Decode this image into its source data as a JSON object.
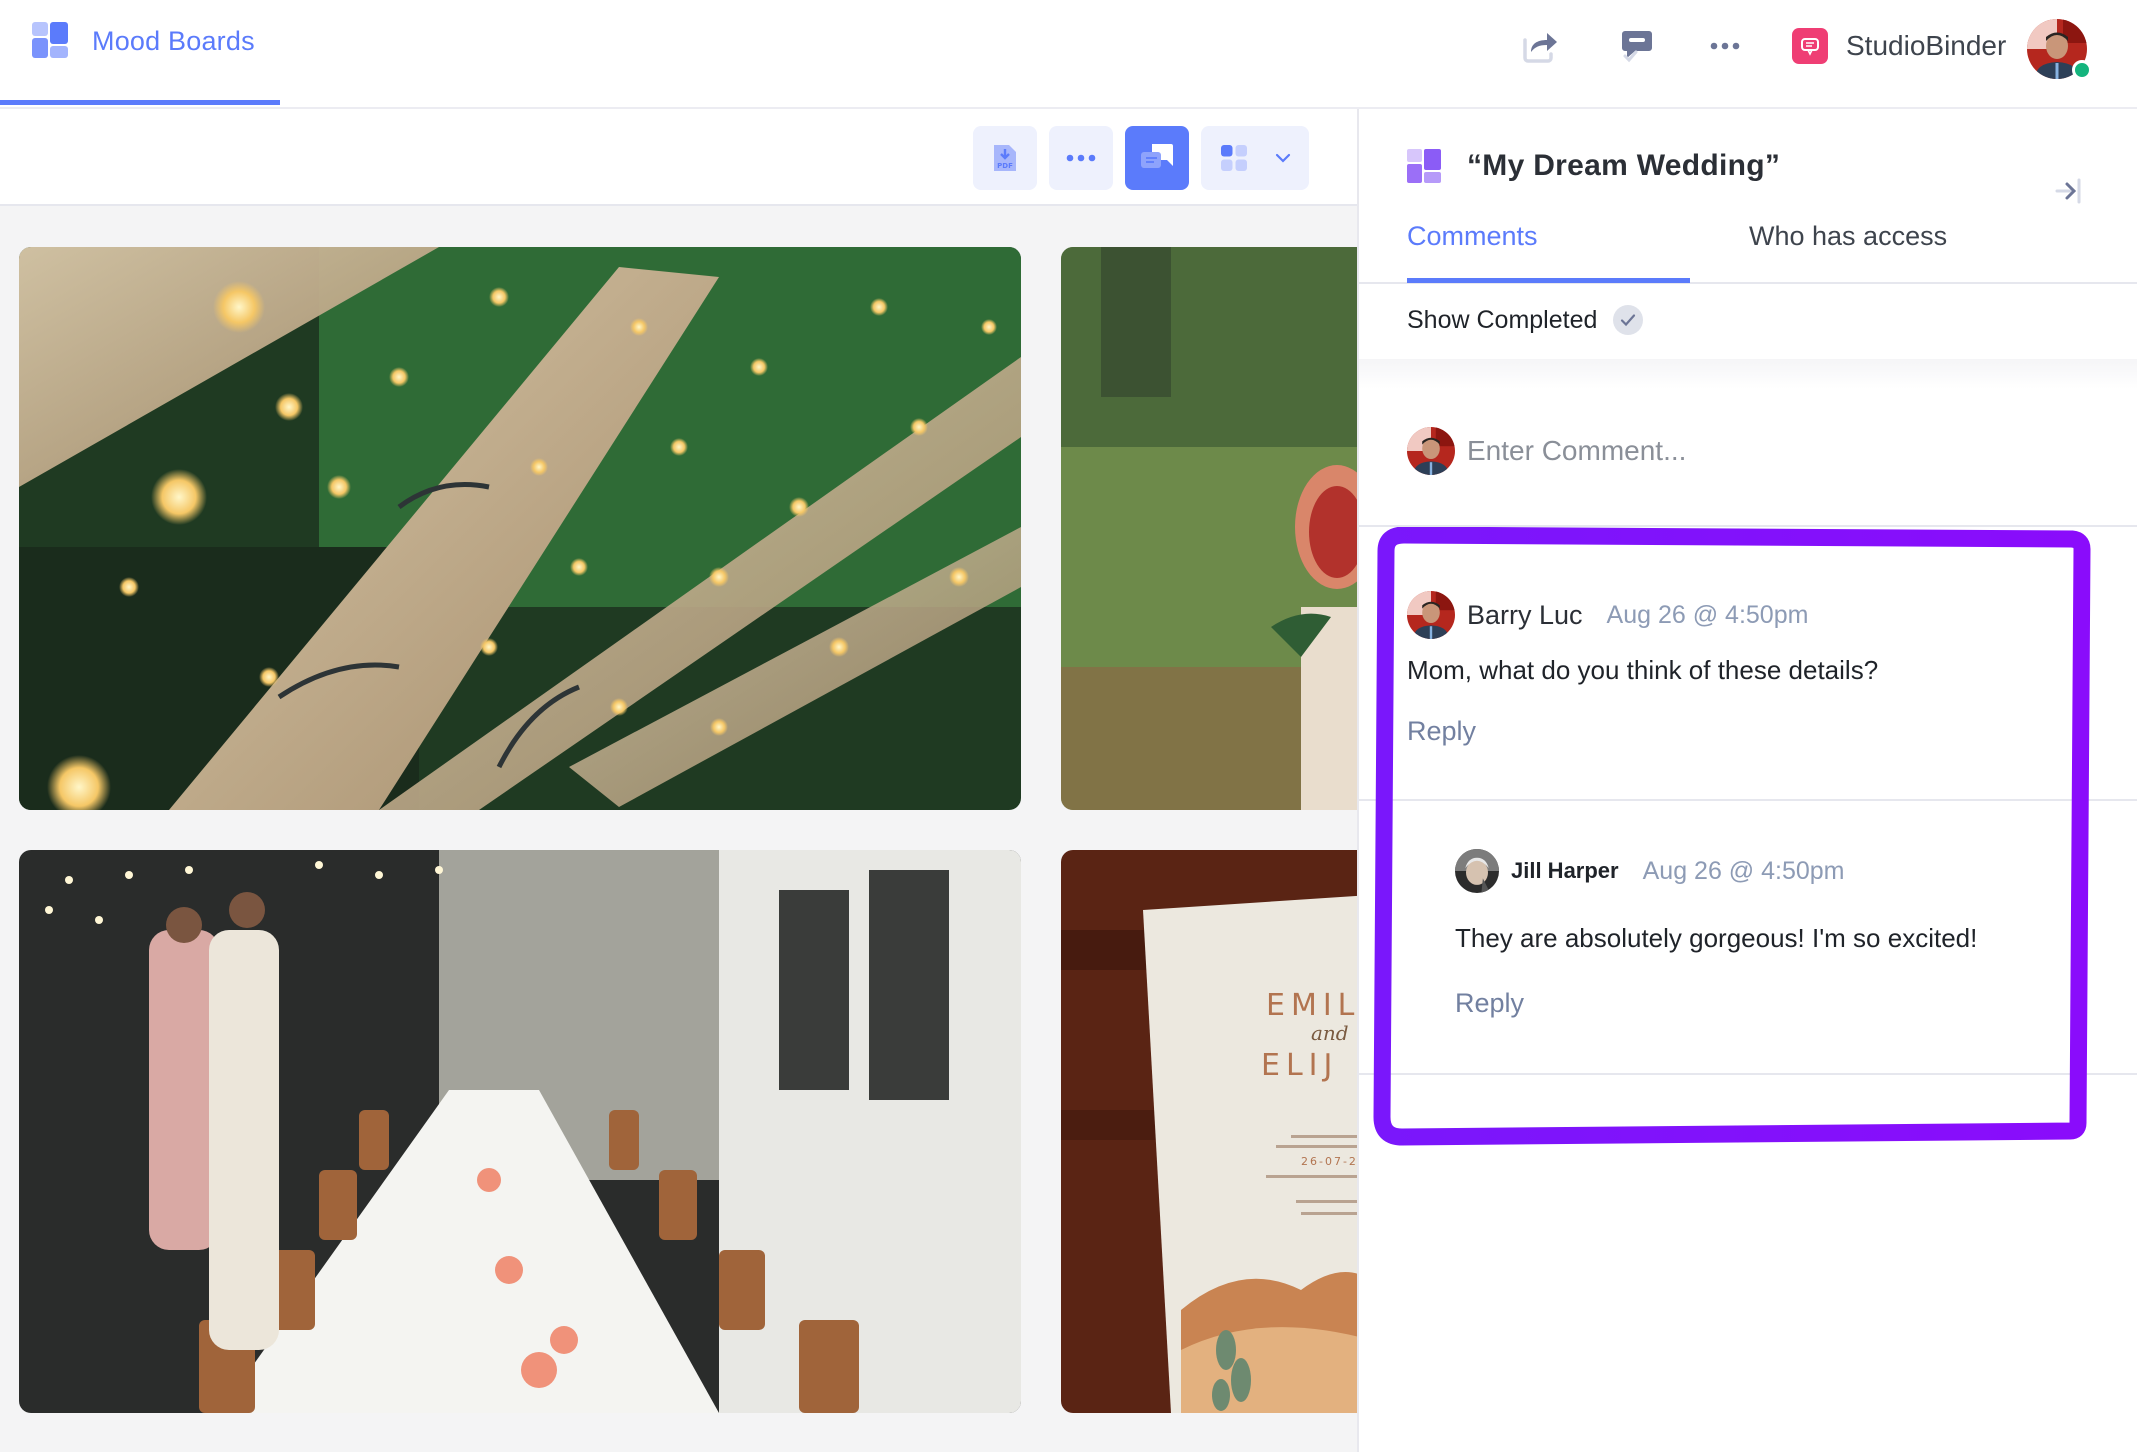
{
  "header": {
    "app_tab": {
      "label": "Mood Boards",
      "icon": "mood-board-icon",
      "accent": "#5b7bfb"
    },
    "actions": [
      {
        "name": "share",
        "icon": "share-icon"
      },
      {
        "name": "comments-toggle",
        "icon": "comment-check-icon"
      },
      {
        "name": "more",
        "icon": "more-dots-icon"
      }
    ],
    "brand": {
      "name": "StudioBinder",
      "icon": "studiobinder-logo-icon",
      "color": "#ef3e74"
    },
    "user": {
      "status": "online",
      "status_color": "#14b47d"
    }
  },
  "toolbar": {
    "buttons": [
      {
        "name": "export-pdf",
        "icon": "pdf-download-icon",
        "label": "PDF",
        "active": false
      },
      {
        "name": "more",
        "icon": "more-dots-icon",
        "active": false
      },
      {
        "name": "comments",
        "icon": "comments-icon",
        "active": true
      },
      {
        "name": "view-mode",
        "icon": "grid-view-icon",
        "dropdown": "chevron-down-icon",
        "active": false
      }
    ]
  },
  "gallery": {
    "images": [
      {
        "description": "Wooden beams wrapped in fairy lights over greenery"
      },
      {
        "description": "Sliced fig on a candle holder with blurred lawn"
      },
      {
        "description": "Couple beside a long outdoor banquet table with rattan chairs"
      },
      {
        "description": "Wedding invitation card on wooden table",
        "card_text": [
          "EMIL",
          "and",
          "ELIJ",
          "26-07-2"
        ]
      }
    ]
  },
  "panel": {
    "title": "“My Dream Wedding”",
    "title_icon": "mood-board-icon",
    "title_icon_color": "#8b5cf6",
    "collapse_icon": "collapse-right-icon",
    "tabs": [
      {
        "label": "Comments",
        "active": true
      },
      {
        "label": "Who has access",
        "active": false
      }
    ],
    "show_completed": {
      "label": "Show Completed",
      "checked": true
    },
    "comment_input": {
      "placeholder": "Enter Comment...",
      "value": ""
    },
    "comments": [
      {
        "author": "Barry Luc",
        "time": "Aug 26 @ 4:50pm",
        "text": "Mom, what do you think of these details?",
        "reply_label": "Reply",
        "replies": [
          {
            "author": "Jill Harper",
            "time": "Aug 26 @ 4:50pm",
            "text": "They are absolutely gorgeous! I'm so excited!",
            "reply_label": "Reply"
          }
        ]
      }
    ],
    "highlight_color": "#8a0cfb"
  }
}
